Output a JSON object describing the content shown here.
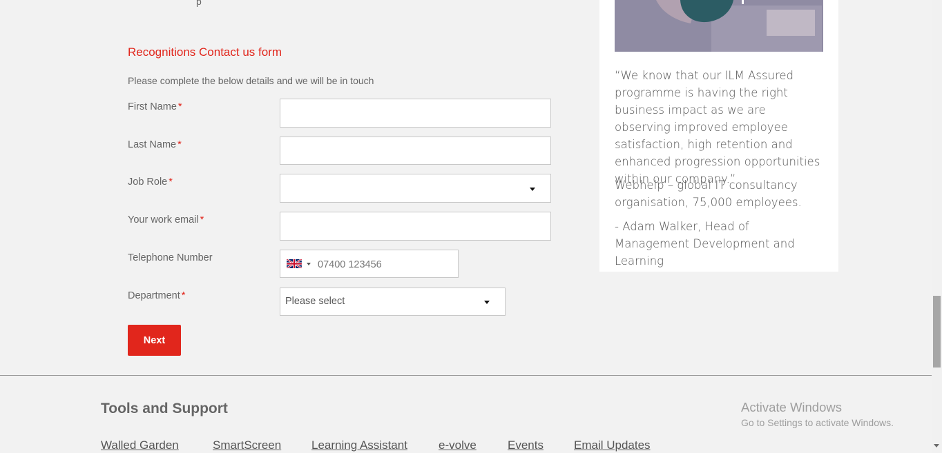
{
  "top_fragment": "p",
  "form": {
    "title": "Recognitions Contact us form",
    "intro": "Please complete the below details and we will be in touch",
    "required_marker": "*",
    "fields": {
      "first_name": {
        "label": "First Name",
        "value": ""
      },
      "last_name": {
        "label": "Last Name",
        "value": ""
      },
      "job_role": {
        "label": "Job Role",
        "selected": ""
      },
      "work_email": {
        "label": "Your work email",
        "value": ""
      },
      "telephone": {
        "label": "Telephone Number",
        "placeholder": "07400 123456",
        "country_flag": "uk-flag-icon"
      },
      "department": {
        "label": "Department",
        "selected": "Please select"
      }
    },
    "next_label": "Next"
  },
  "testimonial": {
    "quote": "“We know that our ILM Assured programme is having the right business impact as we are observing improved employee satisfaction, high retention and enhanced progression opportunities within our company.”",
    "organisation": "Webhelp – global IT consultancy organisation, 75,000 employees.",
    "author": "- Adam Walker, Head of Management Development and Learning"
  },
  "footer": {
    "heading": "Tools and Support",
    "links": [
      "Walled Garden",
      "SmartScreen",
      "Learning Assistant",
      "e-volve",
      "Events",
      "Email Updates"
    ]
  },
  "watermark": {
    "title": "Activate Windows",
    "subtitle": "Go to Settings to activate Windows."
  },
  "colors": {
    "accent": "#e1261c",
    "page_background": "#f2f2f2",
    "card_background": "#ffffff",
    "text": "#555555"
  }
}
